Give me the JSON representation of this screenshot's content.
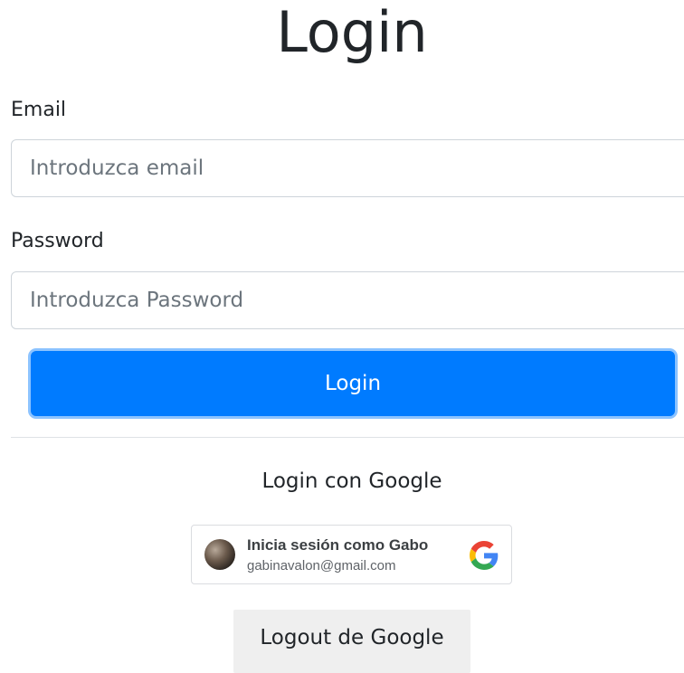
{
  "page": {
    "title": "Login"
  },
  "form": {
    "email_label": "Email",
    "email_placeholder": "Introduzca email",
    "password_label": "Password",
    "password_placeholder": "Introduzca Password",
    "submit_label": "Login"
  },
  "google": {
    "section_title": "Login con Google",
    "signin_button": {
      "name_line": "Inicia sesión como Gabo",
      "email_line": "gabinavalon@gmail.com",
      "logo_icon": "google-g-icon",
      "avatar_icon": "user-avatar"
    },
    "logout_label": "Logout de Google"
  },
  "colors": {
    "primary": "#007bff",
    "input_border": "#ced4da",
    "secondary_button": "#efefef",
    "google_blue": "#4285F4",
    "google_red": "#EA4335",
    "google_yellow": "#FBBC05",
    "google_green": "#34A853"
  }
}
